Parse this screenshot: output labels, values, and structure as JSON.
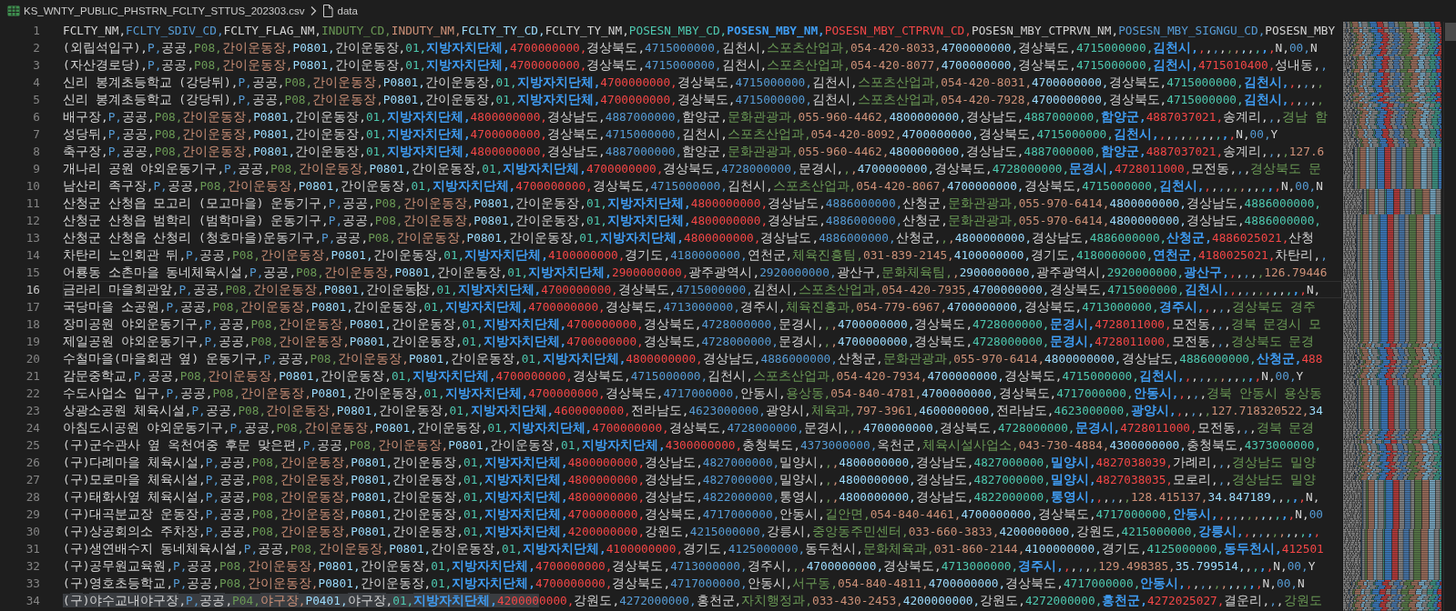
{
  "breadcrumb": {
    "file": "KS_WNTY_PUBLIC_PHSTRN_FCLTY_STTUS_202303.csv",
    "section": "data"
  },
  "editor": {
    "lines": [
      {
        "number": "1",
        "current": false,
        "text": "FCLTY_NM,FCLTY_SDIV_CD,FCLTY_FLAG_NM,INDUTY_CD,INDUTY_NM,FCLTY_TY_CD,FCLTY_TY_NM,POSESN_MBY_CD,POSESN_MBY_NM,POSESN_MBY_CTPRVN_CD,POSESN_MBY_CTPRVN_NM,POSESN_MBY_SIGNGU_CD,POSESN_MBY"
      },
      {
        "number": "2",
        "current": false,
        "text": "(외립석입구),P,공공,P08,간이운동장,P0801,간이운동장,01,지방자치단체,4700000000,경상북도,4715000000,김천시,스포츠산업과,054-420-8033,4700000000,경상북도,4715000000,김천시,,,,,,,,,,,,N,00,N"
      },
      {
        "number": "3",
        "current": false,
        "text": "(자산경로당),P,공공,P08,간이운동장,P0801,간이운동장,01,지방자치단체,4700000000,경상북도,4715000000,김천시,스포츠산업과,054-420-8077,4700000000,경상북도,4715000000,김천시,4715010400,성내동,,"
      },
      {
        "number": "4",
        "current": false,
        "text": "신리 봉계초등학교 (강당뒤),P,공공,P08,간이운동장,P0801,간이운동장,01,지방자치단체,4700000000,경상북도,4715000000,김천시,스포츠산업과,054-420-8031,4700000000,경상북도,4715000000,김천시,,,,,,"
      },
      {
        "number": "5",
        "current": false,
        "text": "신리 봉계초등학교 (강당뒤),P,공공,P08,간이운동장,P0801,간이운동장,01,지방자치단체,4700000000,경상북도,4715000000,김천시,스포츠산업과,054-420-7928,4700000000,경상북도,4715000000,김천시,,,,,,"
      },
      {
        "number": "6",
        "current": false,
        "text": "배구장,P,공공,P08,간이운동장,P0801,간이운동장,01,지방자치단체,4800000000,경상남도,4887000000,함양군,문화관광과,055-960-4462,4800000000,경상남도,4887000000,함양군,4887037021,송계리,,,경남 함"
      },
      {
        "number": "7",
        "current": false,
        "text": "성당뒤,P,공공,P08,간이운동장,P0801,간이운동장,01,지방자치단체,4700000000,경상북도,4715000000,김천시,스포츠산업과,054-420-8092,4700000000,경상북도,4715000000,김천시,,,,,,,,,,,,N,00,Y"
      },
      {
        "number": "8",
        "current": false,
        "text": "축구장,P,공공,P08,간이운동장,P0801,간이운동장,01,지방자치단체,4800000000,경상남도,4887000000,함양군,문화관광과,055-960-4462,4800000000,경상남도,4887000000,함양군,4887037021,송계리,,,,127.6"
      },
      {
        "number": "9",
        "current": false,
        "text": "개나리 공원 야외운동기구,P,공공,P08,간이운동장,P0801,간이운동장,01,지방자치단체,4700000000,경상북도,4728000000,문경시,,,4700000000,경상북도,4728000000,문경시,4728011000,모전동,,,경상북도 문"
      },
      {
        "number": "10",
        "current": false,
        "text": "남산리 족구장,P,공공,P08,간이운동장,P0801,간이운동장,01,지방자치단체,4700000000,경상북도,4715000000,김천시,스포츠산업과,054-420-8067,4700000000,경상북도,4715000000,김천시,,,,,,,,,,,,N,00,N"
      },
      {
        "number": "11",
        "current": false,
        "text": "산청군 산청읍 모고리 (모고마을) 운동기구,P,공공,P08,간이운동장,P0801,간이운동장,01,지방자치단체,4800000000,경상남도,4886000000,산청군,문화관광과,055-970-6414,4800000000,경상남도,4886000000,"
      },
      {
        "number": "12",
        "current": false,
        "text": "산청군 산청읍 범학리 (범학마을) 운동기구,P,공공,P08,간이운동장,P0801,간이운동장,01,지방자치단체,4800000000,경상남도,4886000000,산청군,문화관광과,055-970-6414,4800000000,경상남도,4886000000,"
      },
      {
        "number": "13",
        "current": false,
        "text": "산청군 산청읍 산청리 (청호마을)운동기구,P,공공,P08,간이운동장,P0801,간이운동장,01,지방자치단체,4800000000,경상남도,4886000000,산청군,,,4800000000,경상남도,4886000000,산청군,4886025021,산청"
      },
      {
        "number": "14",
        "current": false,
        "text": "차탄리 노인회관 뒤,P,공공,P08,간이운동장,P0801,간이운동장,01,지방자치단체,4100000000,경기도,4180000000,연천군,체육진흥팀,031-839-2145,4100000000,경기도,4180000000,연천군,4180025021,차탄리,,"
      },
      {
        "number": "15",
        "current": false,
        "text": "어룡동 소촌마을 동네체육시설,P,공공,P08,간이운동장,P0801,간이운동장,01,지방자치단체,2900000000,광주광역시,2920000000,광산구,문화체육팀,,2900000000,광주광역시,2920000000,광산구,,,,,,126.79446"
      },
      {
        "number": "16",
        "current": true,
        "text": "금라리 마을회관앞,P,공공,P08,간이운동장,P0801,간이운동",
        "text_after_cursor": "장,01,지방자치단체,4700000000,경상북도,4715000000,김천시,스포츠산업과,054-420-7935,4700000000,경상북도,4715000000,김천시,,,,,,,,,,,,N,"
      },
      {
        "number": "17",
        "current": false,
        "text": "국당마을 소공원,P,공공,P08,간이운동장,P0801,간이운동장,01,지방자치단체,4700000000,경상북도,4713000000,경주시,체육진흥과,054-779-6967,4700000000,경상북도,4713000000,경주시,,,,,경상북도 경주"
      },
      {
        "number": "18",
        "current": false,
        "text": "장미공원 야외운동기구,P,공공,P08,간이운동장,P0801,간이운동장,01,지방자치단체,4700000000,경상북도,4728000000,문경시,,,4700000000,경상북도,4728000000,문경시,4728011000,모전동,,,경북 문경시 모"
      },
      {
        "number": "19",
        "current": false,
        "text": "제일공원 야외운동기구,P,공공,P08,간이운동장,P0801,간이운동장,01,지방자치단체,4700000000,경상북도,4728000000,문경시,,,4700000000,경상북도,4728000000,문경시,4728011000,모전동,,,경상북도 문경"
      },
      {
        "number": "20",
        "current": false,
        "text": "수철마을(마을회관 옆) 운동기구,P,공공,P08,간이운동장,P0801,간이운동장,01,지방자치단체,4800000000,경상남도,4886000000,산청군,문화관광과,055-970-6414,4800000000,경상남도,4886000000,산청군,488"
      },
      {
        "number": "21",
        "current": false,
        "text": "감문중학교,P,공공,P08,간이운동장,P0801,간이운동장,01,지방자치단체,4700000000,경상북도,4715000000,김천시,스포츠산업과,054-420-7934,4700000000,경상북도,4715000000,김천시,,,,,,,,,,,,N,00,Y"
      },
      {
        "number": "22",
        "current": false,
        "text": "수도사업소 입구,P,공공,P08,간이운동장,P0801,간이운동장,01,지방자치단체,4700000000,경상북도,4717000000,안동시,용상동,054-840-4781,4700000000,경상북도,4717000000,안동시,,,,,경북 안동시 용상동"
      },
      {
        "number": "23",
        "current": false,
        "text": "상광소공원 체육시설,P,공공,P08,간이운동장,P0801,간이운동장,01,지방자치단체,4600000000,전라남도,4623000000,광양시,체육과,797-3961,4600000000,전라남도,4623000000,광양시,,,,,,127.718320522,34"
      },
      {
        "number": "24",
        "current": false,
        "text": "아침도시공원 야외운동기구,P,공공,P08,간이운동장,P0801,간이운동장,01,지방자치단체,4700000000,경상북도,4728000000,문경시,,,4700000000,경상북도,4728000000,문경시,4728011000,모전동,,,경북 문경"
      },
      {
        "number": "25",
        "current": false,
        "text": "(구)군수관사 옆 옥천여중 후문 맞은편,P,공공,P08,간이운동장,P0801,간이운동장,01,지방자치단체,4300000000,충청북도,4373000000,옥천군,체육시설사업소,043-730-4884,4300000000,충청북도,4373000000,"
      },
      {
        "number": "26",
        "current": false,
        "text": "(구)다례마을 체육시설,P,공공,P08,간이운동장,P0801,간이운동장,01,지방자치단체,4800000000,경상남도,4827000000,밀양시,,,4800000000,경상남도,4827000000,밀양시,4827038039,가례리,,,경상남도 밀양"
      },
      {
        "number": "27",
        "current": false,
        "text": "(구)모로마을 체육시설,P,공공,P08,간이운동장,P0801,간이운동장,01,지방자치단체,4800000000,경상남도,4827000000,밀양시,,,4800000000,경상남도,4827000000,밀양시,4827038035,모로리,,,경상남도 밀양"
      },
      {
        "number": "28",
        "current": false,
        "text": "(구)태화사옆 체육시설,P,공공,P08,간이운동장,P0801,간이운동장,01,지방자치단체,4800000000,경상남도,4822000000,통영시,,,4800000000,경상남도,4822000000,통영시,,,,,,128.415137,34.847189,,,,,N,"
      },
      {
        "number": "29",
        "current": false,
        "text": "(구)대곡분교장 운동장,P,공공,P08,간이운동장,P0801,간이운동장,01,지방자치단체,4700000000,경상북도,4717000000,안동시,길안면,054-840-4461,4700000000,경상북도,4717000000,안동시,,,,,,,,,,,,N,00"
      },
      {
        "number": "30",
        "current": false,
        "text": "(구)상공회의소 주차장,P,공공,P08,간이운동장,P0801,간이운동장,01,지방자치단체,4200000000,강원도,4215000000,강릉시,중앙동주민센터,033-660-3833,4200000000,강원도,4215000000,강릉시,,,,,,,,,,,,"
      },
      {
        "number": "31",
        "current": false,
        "text": "(구)생연배수지 동네체육시설,P,공공,P08,간이운동장,P0801,간이운동장,01,지방자치단체,4100000000,경기도,4125000000,동두천시,문화체육과,031-860-2144,4100000000,경기도,4125000000,동두천시,412501"
      },
      {
        "number": "32",
        "current": false,
        "text": "(구)공무원교육원,P,공공,P08,간이운동장,P0801,간이운동장,01,지방자치단체,4700000000,경상북도,4713000000,경주시,,,4700000000,경상북도,4713000000,경주시,,,,,,129.498385,35.799514,,,,,N,00,Y"
      },
      {
        "number": "33",
        "current": false,
        "text": "(구)영호초등학교,P,공공,P08,간이운동장,P0801,간이운동장,01,지방자치단체,4700000000,경상북도,4717000000,안동시,서구동,054-840-4811,4700000000,경상북도,4717000000,안동시,,,,,,,,,,,,N,00,N"
      },
      {
        "number": "34",
        "current": false,
        "selected_text": "(구)야수교내야구장,P,공공,P04,야구장,P0401,야구장,01,지방자치단체,420000",
        "text": "0000,강원도,4272000000,홍천군,자치행정과,033-430-2453,4200000000,강원도,4272000000,홍천군,4272025027,결운리,,,강원도"
      }
    ]
  }
}
